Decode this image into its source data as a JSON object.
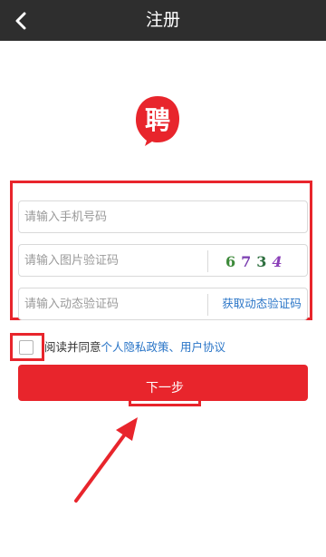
{
  "header": {
    "title": "注册",
    "back_icon": "chevron-left-icon"
  },
  "logo": {
    "text": "聘",
    "color": "#e8252c"
  },
  "form": {
    "phone_placeholder": "请输入手机号码",
    "image_code_placeholder": "请输入图片验证码",
    "captcha_digits": [
      "6",
      "7",
      "3",
      "4"
    ],
    "sms_code_placeholder": "请输入动态验证码",
    "get_sms_code_label": "获取动态验证码"
  },
  "agreement": {
    "prefix": "阅读并同意",
    "privacy_link": "个人隐私政策",
    "separator": "、",
    "terms_link": "用户协议",
    "checked": false
  },
  "next_button": {
    "label": "下一步"
  },
  "colors": {
    "accent": "#e8252c",
    "header_bg": "#2e2e2e",
    "link": "#2a75c7"
  }
}
